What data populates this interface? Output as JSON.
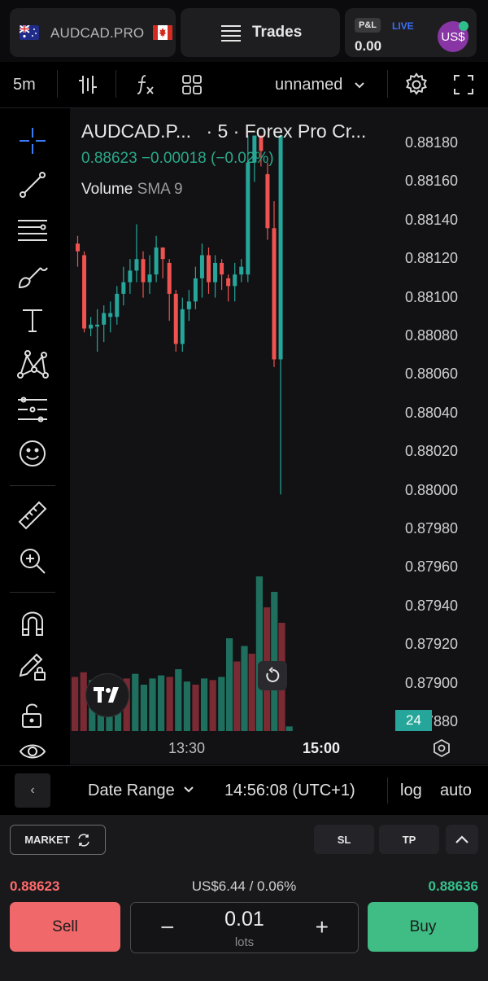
{
  "header": {
    "symbol": "AUDCAD.PRO",
    "trades_label": "Trades",
    "pnl_badge": "P&L",
    "live_badge": "LIVE",
    "pnl_value": "0.00",
    "avatar_text": "US$"
  },
  "toolbar": {
    "interval": "5m",
    "layout_name": "unnamed"
  },
  "legend": {
    "title": "AUDCAD.P...",
    "source": "· 5 · Forex Pro Cr...",
    "price_line": "0.88623  −0.00018 (−0.02%)",
    "volume_label": "Volume",
    "volume_sma": "SMA 9"
  },
  "chart_data": {
    "type": "candlestick",
    "y_axis_ticks": [
      "0.88180",
      "0.88160",
      "0.88140",
      "0.88120",
      "0.88100",
      "0.88080",
      "0.88060",
      "0.88040",
      "0.88020",
      "0.88000",
      "0.87980",
      "0.87960",
      "0.87940",
      "0.87920",
      "0.87900",
      "0.87880"
    ],
    "x_axis_ticks": [
      "13:30",
      "15:00"
    ],
    "ylim": [
      0.8788,
      0.88184
    ],
    "candles": [
      {
        "o": 0.88124,
        "c": 0.88128,
        "h": 0.88132,
        "l": 0.88116,
        "dir": "down"
      },
      {
        "o": 0.88122,
        "c": 0.88084,
        "h": 0.88124,
        "l": 0.88082,
        "dir": "down"
      },
      {
        "o": 0.88084,
        "c": 0.88086,
        "h": 0.8809,
        "l": 0.8808,
        "dir": "up"
      },
      {
        "o": 0.88086,
        "c": 0.88085,
        "h": 0.88094,
        "l": 0.88072,
        "dir": "up"
      },
      {
        "o": 0.88086,
        "c": 0.88092,
        "h": 0.88096,
        "l": 0.88077,
        "dir": "up"
      },
      {
        "o": 0.88092,
        "c": 0.8809,
        "h": 0.88098,
        "l": 0.88082,
        "dir": "up"
      },
      {
        "o": 0.8809,
        "c": 0.88102,
        "h": 0.88106,
        "l": 0.88086,
        "dir": "up"
      },
      {
        "o": 0.88102,
        "c": 0.88108,
        "h": 0.88116,
        "l": 0.88096,
        "dir": "up"
      },
      {
        "o": 0.88108,
        "c": 0.88114,
        "h": 0.8812,
        "l": 0.88102,
        "dir": "up"
      },
      {
        "o": 0.88114,
        "c": 0.8812,
        "h": 0.88138,
        "l": 0.88108,
        "dir": "up"
      },
      {
        "o": 0.8812,
        "c": 0.88108,
        "h": 0.88124,
        "l": 0.881,
        "dir": "down"
      },
      {
        "o": 0.88108,
        "c": 0.88112,
        "h": 0.88122,
        "l": 0.88102,
        "dir": "up"
      },
      {
        "o": 0.88112,
        "c": 0.88126,
        "h": 0.88132,
        "l": 0.88108,
        "dir": "up"
      },
      {
        "o": 0.88126,
        "c": 0.8812,
        "h": 0.88126,
        "l": 0.8811,
        "dir": "down"
      },
      {
        "o": 0.88118,
        "c": 0.88102,
        "h": 0.8812,
        "l": 0.88088,
        "dir": "down"
      },
      {
        "o": 0.88102,
        "c": 0.88076,
        "h": 0.88104,
        "l": 0.88072,
        "dir": "down"
      },
      {
        "o": 0.88076,
        "c": 0.88094,
        "h": 0.881,
        "l": 0.88072,
        "dir": "up"
      },
      {
        "o": 0.88094,
        "c": 0.88098,
        "h": 0.88104,
        "l": 0.88088,
        "dir": "up"
      },
      {
        "o": 0.88098,
        "c": 0.8811,
        "h": 0.88116,
        "l": 0.88094,
        "dir": "up"
      },
      {
        "o": 0.8811,
        "c": 0.88122,
        "h": 0.88128,
        "l": 0.881,
        "dir": "up"
      },
      {
        "o": 0.88122,
        "c": 0.88108,
        "h": 0.88126,
        "l": 0.88102,
        "dir": "down"
      },
      {
        "o": 0.88108,
        "c": 0.88118,
        "h": 0.88122,
        "l": 0.881,
        "dir": "up"
      },
      {
        "o": 0.88118,
        "c": 0.88112,
        "h": 0.8812,
        "l": 0.88104,
        "dir": "down"
      },
      {
        "o": 0.8811,
        "c": 0.88106,
        "h": 0.88112,
        "l": 0.88098,
        "dir": "down"
      },
      {
        "o": 0.88106,
        "c": 0.88112,
        "h": 0.88118,
        "l": 0.88098,
        "dir": "up"
      },
      {
        "o": 0.88112,
        "c": 0.88116,
        "h": 0.8812,
        "l": 0.88108,
        "dir": "up"
      },
      {
        "o": 0.88112,
        "c": 0.8817,
        "h": 0.88184,
        "l": 0.88108,
        "dir": "up"
      },
      {
        "o": 0.8817,
        "c": 0.88184,
        "h": 0.88184,
        "l": 0.8816,
        "dir": "up"
      },
      {
        "o": 0.88184,
        "c": 0.88176,
        "h": 0.88184,
        "l": 0.88168,
        "dir": "down"
      },
      {
        "o": 0.88164,
        "c": 0.88136,
        "h": 0.8817,
        "l": 0.8813,
        "dir": "down"
      },
      {
        "o": 0.88136,
        "c": 0.88068,
        "h": 0.8815,
        "l": 0.88064,
        "dir": "down"
      },
      {
        "o": 0.88068,
        "c": 0.88184,
        "h": 0.88184,
        "l": 0.87998,
        "dir": "up"
      }
    ],
    "volume_label": "24"
  },
  "footer": {
    "date_range": "Date Range",
    "clock": "14:56:08 (UTC+1)",
    "log": "log",
    "auto": "auto"
  },
  "order": {
    "market_label": "MARKET",
    "sl_label": "SL",
    "tp_label": "TP",
    "sell_price": "0.88623",
    "spread": "US$6.44 / 0.06%",
    "buy_price": "0.88636",
    "sell_label": "Sell",
    "buy_label": "Buy",
    "lots_value": "0.01",
    "lots_unit": "lots",
    "minus": "−",
    "plus": "+"
  },
  "colors": {
    "up": "#26a69a",
    "down": "#ef5350",
    "sell": "#f0686a",
    "buy": "#3fbd84"
  }
}
